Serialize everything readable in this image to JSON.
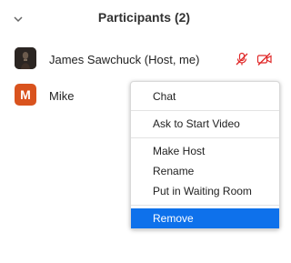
{
  "header": {
    "title": "Participants (2)",
    "collapse_icon": "chevron-down-icon"
  },
  "participants": [
    {
      "name": "James Sawchuck (Host, me)",
      "avatar_type": "photo",
      "mic_state": "muted",
      "video_state": "off",
      "status_color": "#e02828"
    },
    {
      "name": "Mike",
      "avatar_initial": "M",
      "avatar_color": "#d9531e"
    }
  ],
  "context_menu": {
    "items": [
      {
        "label": "Chat"
      },
      {
        "label": "Ask to Start Video"
      },
      {
        "label": "Make Host"
      },
      {
        "label": "Rename"
      },
      {
        "label": "Put in Waiting Room"
      },
      {
        "label": "Remove",
        "selected": true
      }
    ],
    "highlight_color": "#0e71eb"
  }
}
